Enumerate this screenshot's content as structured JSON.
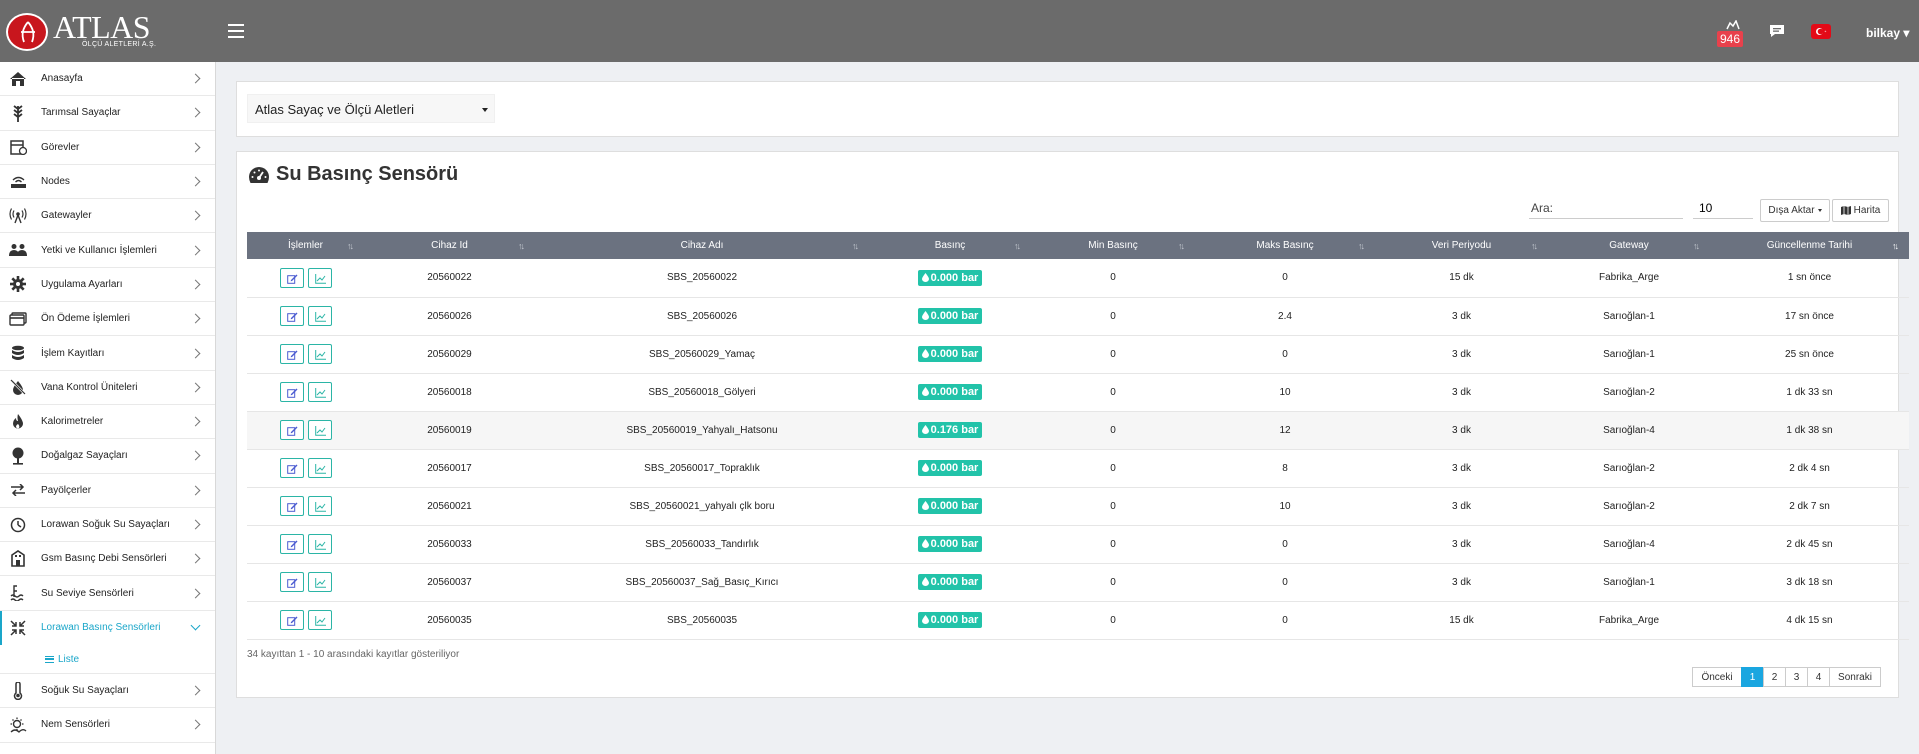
{
  "brand": {
    "name": "ATLAS",
    "subtitle": "ÖLÇÜ ALETLERİ A.Ş."
  },
  "header": {
    "notification_count": "946",
    "user": "bilkay"
  },
  "sidebar": {
    "items": [
      {
        "label": "Anasayfa",
        "icon": "home-icon"
      },
      {
        "label": "Tarımsal Sayaçlar",
        "icon": "wheat-icon"
      },
      {
        "label": "Görevler",
        "icon": "tasks-icon"
      },
      {
        "label": "Nodes",
        "icon": "router-icon"
      },
      {
        "label": "Gatewayler",
        "icon": "antenna-icon"
      },
      {
        "label": "Yetki ve Kullanıcı İşlemleri",
        "icon": "users-icon"
      },
      {
        "label": "Uygulama Ayarları",
        "icon": "gear-icon"
      },
      {
        "label": "Ön Ödeme İşlemleri",
        "icon": "credit-card-icon"
      },
      {
        "label": "İşlem Kayıtları",
        "icon": "database-icon"
      },
      {
        "label": "Vana Kontrol Üniteleri",
        "icon": "valve-icon"
      },
      {
        "label": "Kalorimetreler",
        "icon": "flame-icon"
      },
      {
        "label": "Doğalgaz Sayaçları",
        "icon": "gas-icon"
      },
      {
        "label": "Payölçerler",
        "icon": "exchange-icon"
      },
      {
        "label": "Lorawan Soğuk Su Sayaçları",
        "icon": "meter-icon"
      },
      {
        "label": "Gsm Basınç Debi Sensörleri",
        "icon": "building-icon"
      },
      {
        "label": "Su Seviye Sensörleri",
        "icon": "water-level-icon"
      },
      {
        "label": "Lorawan Basınç Sensörleri",
        "icon": "compress-icon"
      },
      {
        "label": "Soğuk Su Sayaçları",
        "icon": "thermometer-icon"
      },
      {
        "label": "Nem Sensörleri",
        "icon": "humidity-icon"
      }
    ],
    "sub_item": "Liste"
  },
  "company_select": {
    "value": "Atlas Sayaç ve Ölçü Aletleri"
  },
  "page": {
    "title": "Su Basınç Sensörü",
    "search_label": "Ara:",
    "page_length": "10",
    "export_label": "Dışa Aktar",
    "map_label": "Harita"
  },
  "table": {
    "columns": [
      "İşlemler",
      "Cihaz Id",
      "Cihaz Adı",
      "Basınç",
      "Min Basınç",
      "Maks Basınç",
      "Veri Periyodu",
      "Gateway",
      "Güncellenme Tarihi"
    ],
    "rows": [
      {
        "id": "20560022",
        "name": "SBS_20560022",
        "pressure": "0.000 bar",
        "min": "0",
        "max": "0",
        "period": "15 dk",
        "gateway": "Fabrika_Arge",
        "updated": "1 sn önce"
      },
      {
        "id": "20560026",
        "name": "SBS_20560026",
        "pressure": "0.000 bar",
        "min": "0",
        "max": "2.4",
        "period": "3 dk",
        "gateway": "Sarıoğlan-1",
        "updated": "17 sn önce"
      },
      {
        "id": "20560029",
        "name": "SBS_20560029_Yamaç",
        "pressure": "0.000 bar",
        "min": "0",
        "max": "0",
        "period": "3 dk",
        "gateway": "Sarıoğlan-1",
        "updated": "25 sn önce"
      },
      {
        "id": "20560018",
        "name": "SBS_20560018_Gölyeri",
        "pressure": "0.000 bar",
        "min": "0",
        "max": "10",
        "period": "3 dk",
        "gateway": "Sarıoğlan-2",
        "updated": "1 dk 33 sn"
      },
      {
        "id": "20560019",
        "name": "SBS_20560019_Yahyalı_Hatsonu",
        "pressure": "0.176 bar",
        "min": "0",
        "max": "12",
        "period": "3 dk",
        "gateway": "Sarıoğlan-4",
        "updated": "1 dk 38 sn"
      },
      {
        "id": "20560017",
        "name": "SBS_20560017_Topraklık",
        "pressure": "0.000 bar",
        "min": "0",
        "max": "8",
        "period": "3 dk",
        "gateway": "Sarıoğlan-2",
        "updated": "2 dk 4 sn"
      },
      {
        "id": "20560021",
        "name": "SBS_20560021_yahyalı çlk boru",
        "pressure": "0.000 bar",
        "min": "0",
        "max": "10",
        "period": "3 dk",
        "gateway": "Sarıoğlan-2",
        "updated": "2 dk 7 sn"
      },
      {
        "id": "20560033",
        "name": "SBS_20560033_Tandırlık",
        "pressure": "0.000 bar",
        "min": "0",
        "max": "0",
        "period": "3 dk",
        "gateway": "Sarıoğlan-4",
        "updated": "2 dk 45 sn"
      },
      {
        "id": "20560037",
        "name": "SBS_20560037_Sağ_Basıç_Kırıcı",
        "pressure": "0.000 bar",
        "min": "0",
        "max": "0",
        "period": "3 dk",
        "gateway": "Sarıoğlan-1",
        "updated": "3 dk 18 sn"
      },
      {
        "id": "20560035",
        "name": "SBS_20560035",
        "pressure": "0.000 bar",
        "min": "0",
        "max": "0",
        "period": "15 dk",
        "gateway": "Fabrika_Arge",
        "updated": "4 dk 15 sn"
      }
    ]
  },
  "footer": {
    "info": "34 kayıttan 1 - 10 arasındaki kayıtlar gösteriliyor",
    "prev": "Önceki",
    "pages": [
      "1",
      "2",
      "3",
      "4"
    ],
    "next": "Sonraki"
  },
  "colors": {
    "topbar": "#6b6b6b",
    "accent": "#1aa6c9",
    "pill": "#22c3a9",
    "header_row": "#6b7280",
    "brand_red": "#c8161d"
  }
}
